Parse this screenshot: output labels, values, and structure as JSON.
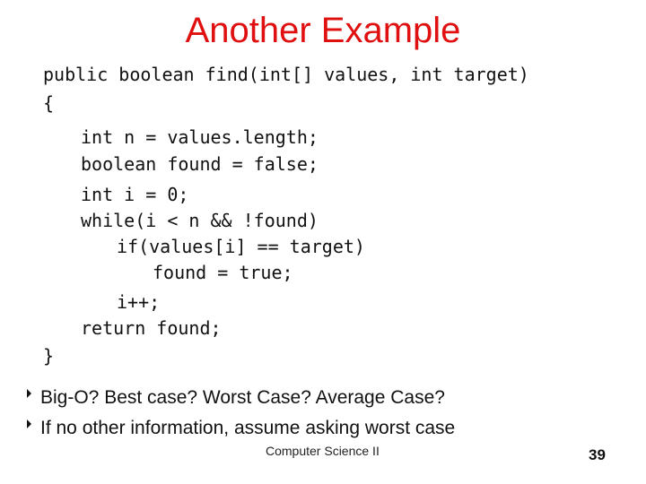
{
  "slide": {
    "title": "Another Example",
    "code_lines": [
      {
        "text": "public boolean find(int[] values, int target)",
        "indent": 0
      },
      {
        "text": "{",
        "indent": 0
      },
      {
        "text": "int n = values.length;",
        "indent": 1
      },
      {
        "text": "boolean found = false;",
        "indent": 1
      },
      {
        "text": "int i = 0;",
        "indent": 1
      },
      {
        "text": "while(i < n && !found)",
        "indent": 1
      },
      {
        "text": "if(values[i] == target)",
        "indent": 2
      },
      {
        "text": "found = true;",
        "indent": 3
      },
      {
        "text": "i++;",
        "indent": 2
      },
      {
        "text": "return found;",
        "indent": 1
      },
      {
        "text": "}",
        "indent": 0
      }
    ],
    "bullets": [
      {
        "icon": "triangle-bullet-icon",
        "text": "Big-O? Best case? Worst Case? Average Case?"
      },
      {
        "icon": "triangle-bullet-icon",
        "text": "If no other information, assume asking worst case"
      }
    ],
    "footer": "Computer Science II",
    "page_number": "39",
    "title_color": "#e01010"
  }
}
